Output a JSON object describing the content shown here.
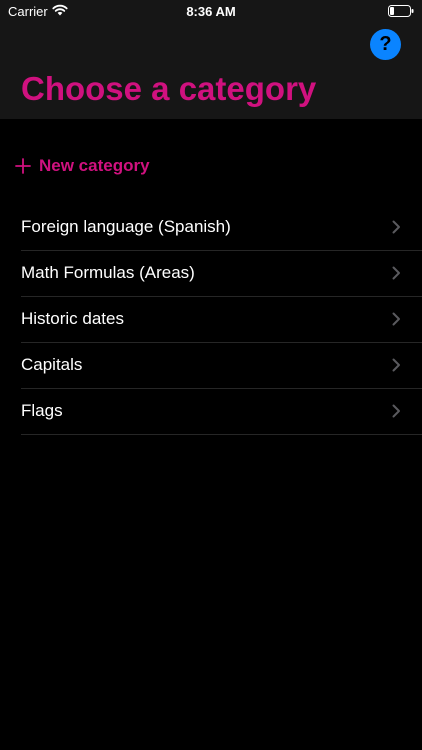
{
  "status_bar": {
    "carrier": "Carrier",
    "time": "8:36 AM",
    "icons": [
      "wifi-icon",
      "battery-icon"
    ]
  },
  "header": {
    "help_label": "?",
    "help_color": "#0a84ff",
    "title": "Choose a category"
  },
  "new_category": {
    "label": "New category",
    "icon": "plus-icon"
  },
  "categories": [
    {
      "label": "Foreign language (Spanish)"
    },
    {
      "label": "Math Formulas (Areas)"
    },
    {
      "label": "Historic dates"
    },
    {
      "label": "Capitals"
    },
    {
      "label": "Flags"
    }
  ],
  "colors": {
    "accent": "#d0117f",
    "background": "#000000",
    "header_background": "#161616",
    "separator": "#262626",
    "chevron": "#5a5a5e"
  }
}
